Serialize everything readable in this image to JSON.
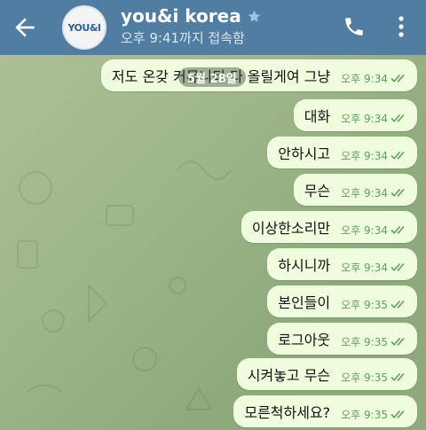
{
  "header": {
    "avatar_text": "YOU&I",
    "title": "you&i korea",
    "status": "오후 9:41까지 접속함"
  },
  "date_pill": "5월 28일",
  "messages": [
    {
      "text": "저도 온갖 커뮤니티 다 올릴게여 그냥",
      "time": "오후 9:34"
    },
    {
      "text": "대화",
      "time": "오후 9:34"
    },
    {
      "text": "안하시고",
      "time": "오후 9:34"
    },
    {
      "text": "무슨",
      "time": "오후 9:34"
    },
    {
      "text": "이상한소리만",
      "time": "오후 9:34"
    },
    {
      "text": "하시니까",
      "time": "오후 9:34"
    },
    {
      "text": "본인들이",
      "time": "오후 9:35"
    },
    {
      "text": "로그아웃",
      "time": "오후 9:35"
    },
    {
      "text": "시켜놓고 무슨",
      "time": "오후 9:35"
    },
    {
      "text": "모른척하세요?",
      "time": "오후 9:35"
    }
  ],
  "colors": {
    "header": "#517da2",
    "bubble_out": "#effdde",
    "tick": "#5fa25a",
    "chat_bg": "#9fb68a"
  }
}
